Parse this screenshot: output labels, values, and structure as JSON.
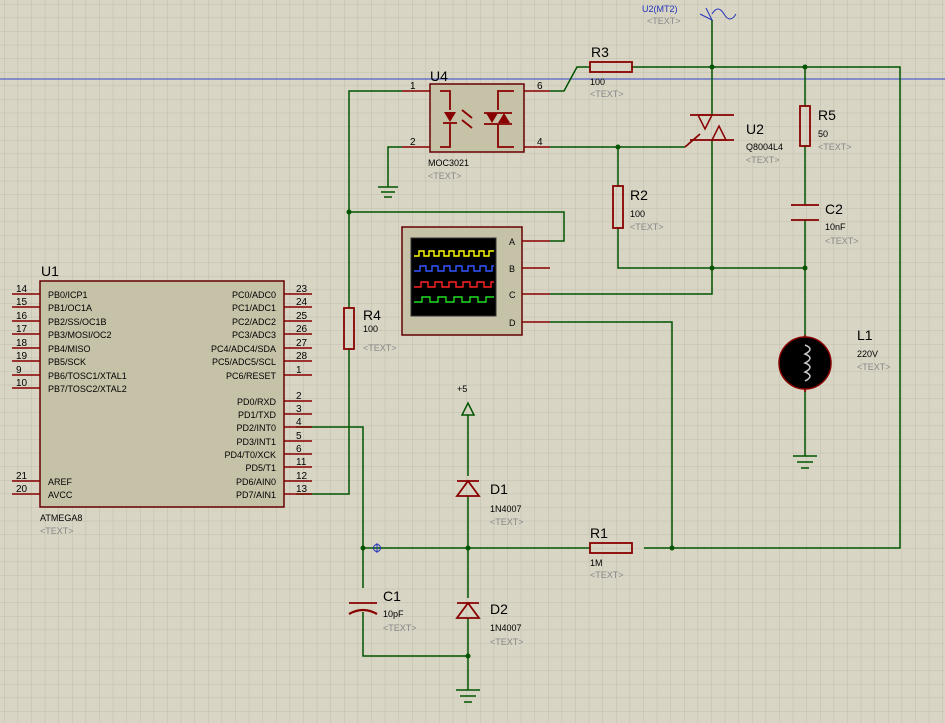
{
  "u1": {
    "ref": "U1",
    "part": "ATMEGA8",
    "text": "<TEXT>",
    "left_pins": [
      {
        "num": "14",
        "name": "PB0/ICP1"
      },
      {
        "num": "15",
        "name": "PB1/OC1A"
      },
      {
        "num": "16",
        "name": "PB2/SS/OC1B"
      },
      {
        "num": "17",
        "name": "PB3/MOSI/OC2"
      },
      {
        "num": "18",
        "name": "PB4/MISO"
      },
      {
        "num": "19",
        "name": "PB5/SCK"
      },
      {
        "num": "9",
        "name": "PB6/TOSC1/XTAL1"
      },
      {
        "num": "10",
        "name": "PB7/TOSC2/XTAL2"
      },
      {
        "num": "21",
        "name": "AREF"
      },
      {
        "num": "20",
        "name": "AVCC"
      }
    ],
    "right_pins": [
      {
        "num": "23",
        "name": "PC0/ADC0"
      },
      {
        "num": "24",
        "name": "PC1/ADC1"
      },
      {
        "num": "25",
        "name": "PC2/ADC2"
      },
      {
        "num": "26",
        "name": "PC3/ADC3"
      },
      {
        "num": "27",
        "name": "PC4/ADC4/SDA"
      },
      {
        "num": "28",
        "name": "PC5/ADC5/SCL"
      },
      {
        "num": "1",
        "name": "PC6/RESET"
      },
      {
        "num": "2",
        "name": "PD0/RXD"
      },
      {
        "num": "3",
        "name": "PD1/TXD"
      },
      {
        "num": "4",
        "name": "PD2/INT0"
      },
      {
        "num": "5",
        "name": "PD3/INT1"
      },
      {
        "num": "6",
        "name": "PD4/T0/XCK"
      },
      {
        "num": "11",
        "name": "PD5/T1"
      },
      {
        "num": "12",
        "name": "PD6/AIN0"
      },
      {
        "num": "13",
        "name": "PD7/AIN1"
      }
    ]
  },
  "u4": {
    "ref": "U4",
    "part": "MOC3021",
    "text": "<TEXT>",
    "pins": [
      "1",
      "2",
      "6",
      "4"
    ]
  },
  "u2": {
    "ref": "U2",
    "part": "Q8004L4",
    "text": "<TEXT>"
  },
  "probe": {
    "label": "U2(MT2)",
    "text": "<TEXT>"
  },
  "r3": {
    "ref": "R3",
    "value": "100",
    "text": "<TEXT>"
  },
  "r5": {
    "ref": "R5",
    "value": "50",
    "text": "<TEXT>"
  },
  "r2": {
    "ref": "R2",
    "value": "100",
    "text": "<TEXT>"
  },
  "r4": {
    "ref": "R4",
    "value": "100",
    "text": "<TEXT>"
  },
  "r1": {
    "ref": "R1",
    "value": "1M",
    "text": "<TEXT>"
  },
  "c2": {
    "ref": "C2",
    "value": "10nF",
    "text": "<TEXT>"
  },
  "c1": {
    "ref": "C1",
    "value": "10pF",
    "text": "<TEXT>"
  },
  "l1": {
    "ref": "L1",
    "value": "220V",
    "text": "<TEXT>"
  },
  "d1": {
    "ref": "D1",
    "part": "1N4007",
    "text": "<TEXT>"
  },
  "d2": {
    "ref": "D2",
    "part": "1N4007",
    "text": "<TEXT>"
  },
  "power": {
    "label": "+5"
  },
  "scope": {
    "channels": [
      "A",
      "B",
      "C",
      "D"
    ],
    "trace_colors": [
      "#ffff00",
      "#3355ff",
      "#ff2222",
      "#22dd22"
    ]
  },
  "colors": {
    "wire": "#005500",
    "component": "#880000",
    "body": "#c6c2a8",
    "grid": "#bab7a6",
    "background": "#d8d5c5"
  }
}
